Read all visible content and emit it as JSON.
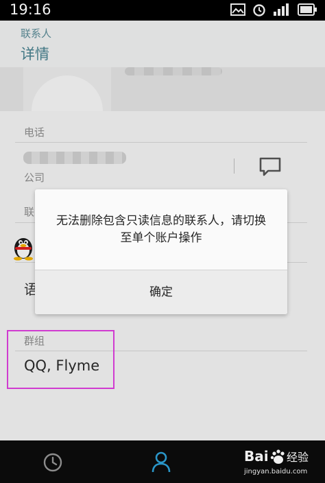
{
  "status_bar": {
    "time": "19:16"
  },
  "header": {
    "subtitle": "联系人",
    "title": "详情"
  },
  "phone_section": {
    "label": "电话",
    "type": "公司"
  },
  "contact_section": {
    "label": "联"
  },
  "language_row": {
    "text": "语"
  },
  "group_section": {
    "label": "群组",
    "value": "QQ, Flyme"
  },
  "dialog": {
    "message": "无法删除包含只读信息的联系人，请切换至单个账户操作",
    "confirm_label": "确定"
  },
  "watermark": {
    "text": "jingyan.baidu.com",
    "logo_text": "Bai 经验"
  },
  "colors": {
    "header_text": "#47808f",
    "nav_active": "#2a96c8",
    "highlight": "#e040e0"
  },
  "icons": [
    "gallery-icon",
    "alarm-icon",
    "signal-icon",
    "battery-icon",
    "message-icon",
    "qq-penguin-icon",
    "recent-clock-icon",
    "contacts-person-icon"
  ]
}
